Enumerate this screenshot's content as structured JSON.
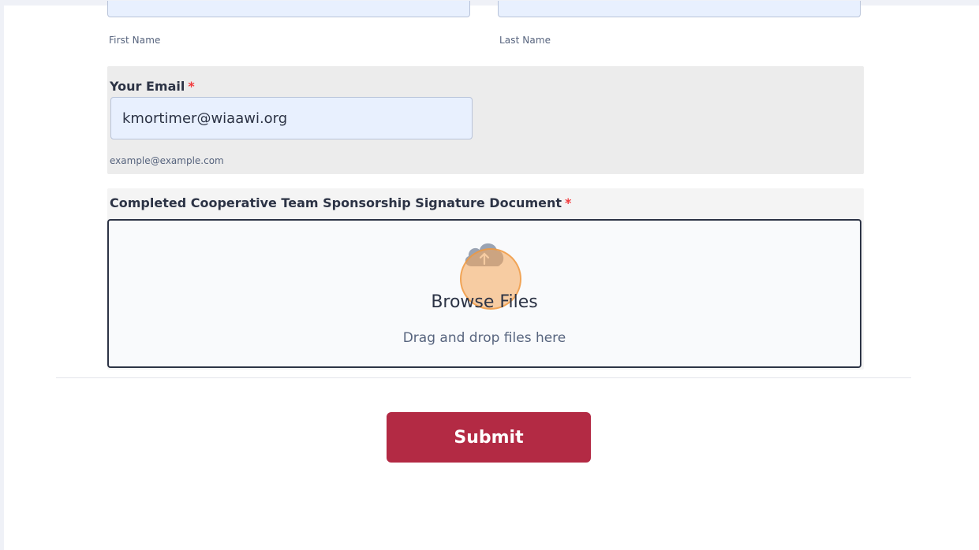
{
  "name_row": {
    "first_name_sublabel": "First Name",
    "last_name_sublabel": "Last Name"
  },
  "email": {
    "label": "Your Email",
    "required_mark": "*",
    "value": "kmortimer@wiaawi.org",
    "hint": "example@example.com"
  },
  "upload": {
    "label": "Completed Cooperative Team Sponsorship Signature Document",
    "required_mark": "*",
    "browse_label": "Browse Files",
    "drag_label": "Drag and drop files here",
    "icon": "cloud-upload-icon"
  },
  "submit": {
    "label": "Submit"
  },
  "colors": {
    "submit_bg": "#b32a44",
    "required": "#f23a3c",
    "input_bg": "#e8f0fe"
  }
}
